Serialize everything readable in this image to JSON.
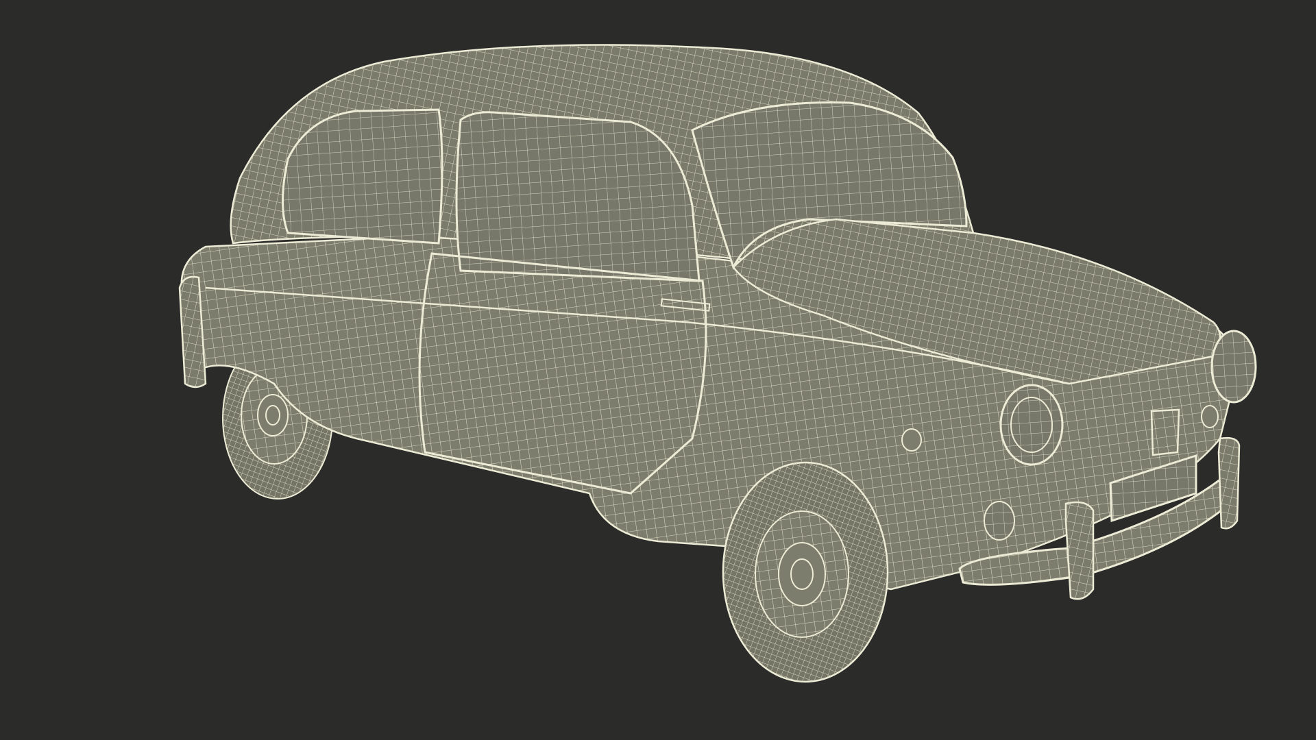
{
  "scene": {
    "background_color": "#2b2b2a",
    "body_fill": "#7c7d6c",
    "wire_color": "#ecebd6",
    "glass_fill": "#77786a",
    "tire_fill": "#747565",
    "subject": "car-wireframe"
  }
}
